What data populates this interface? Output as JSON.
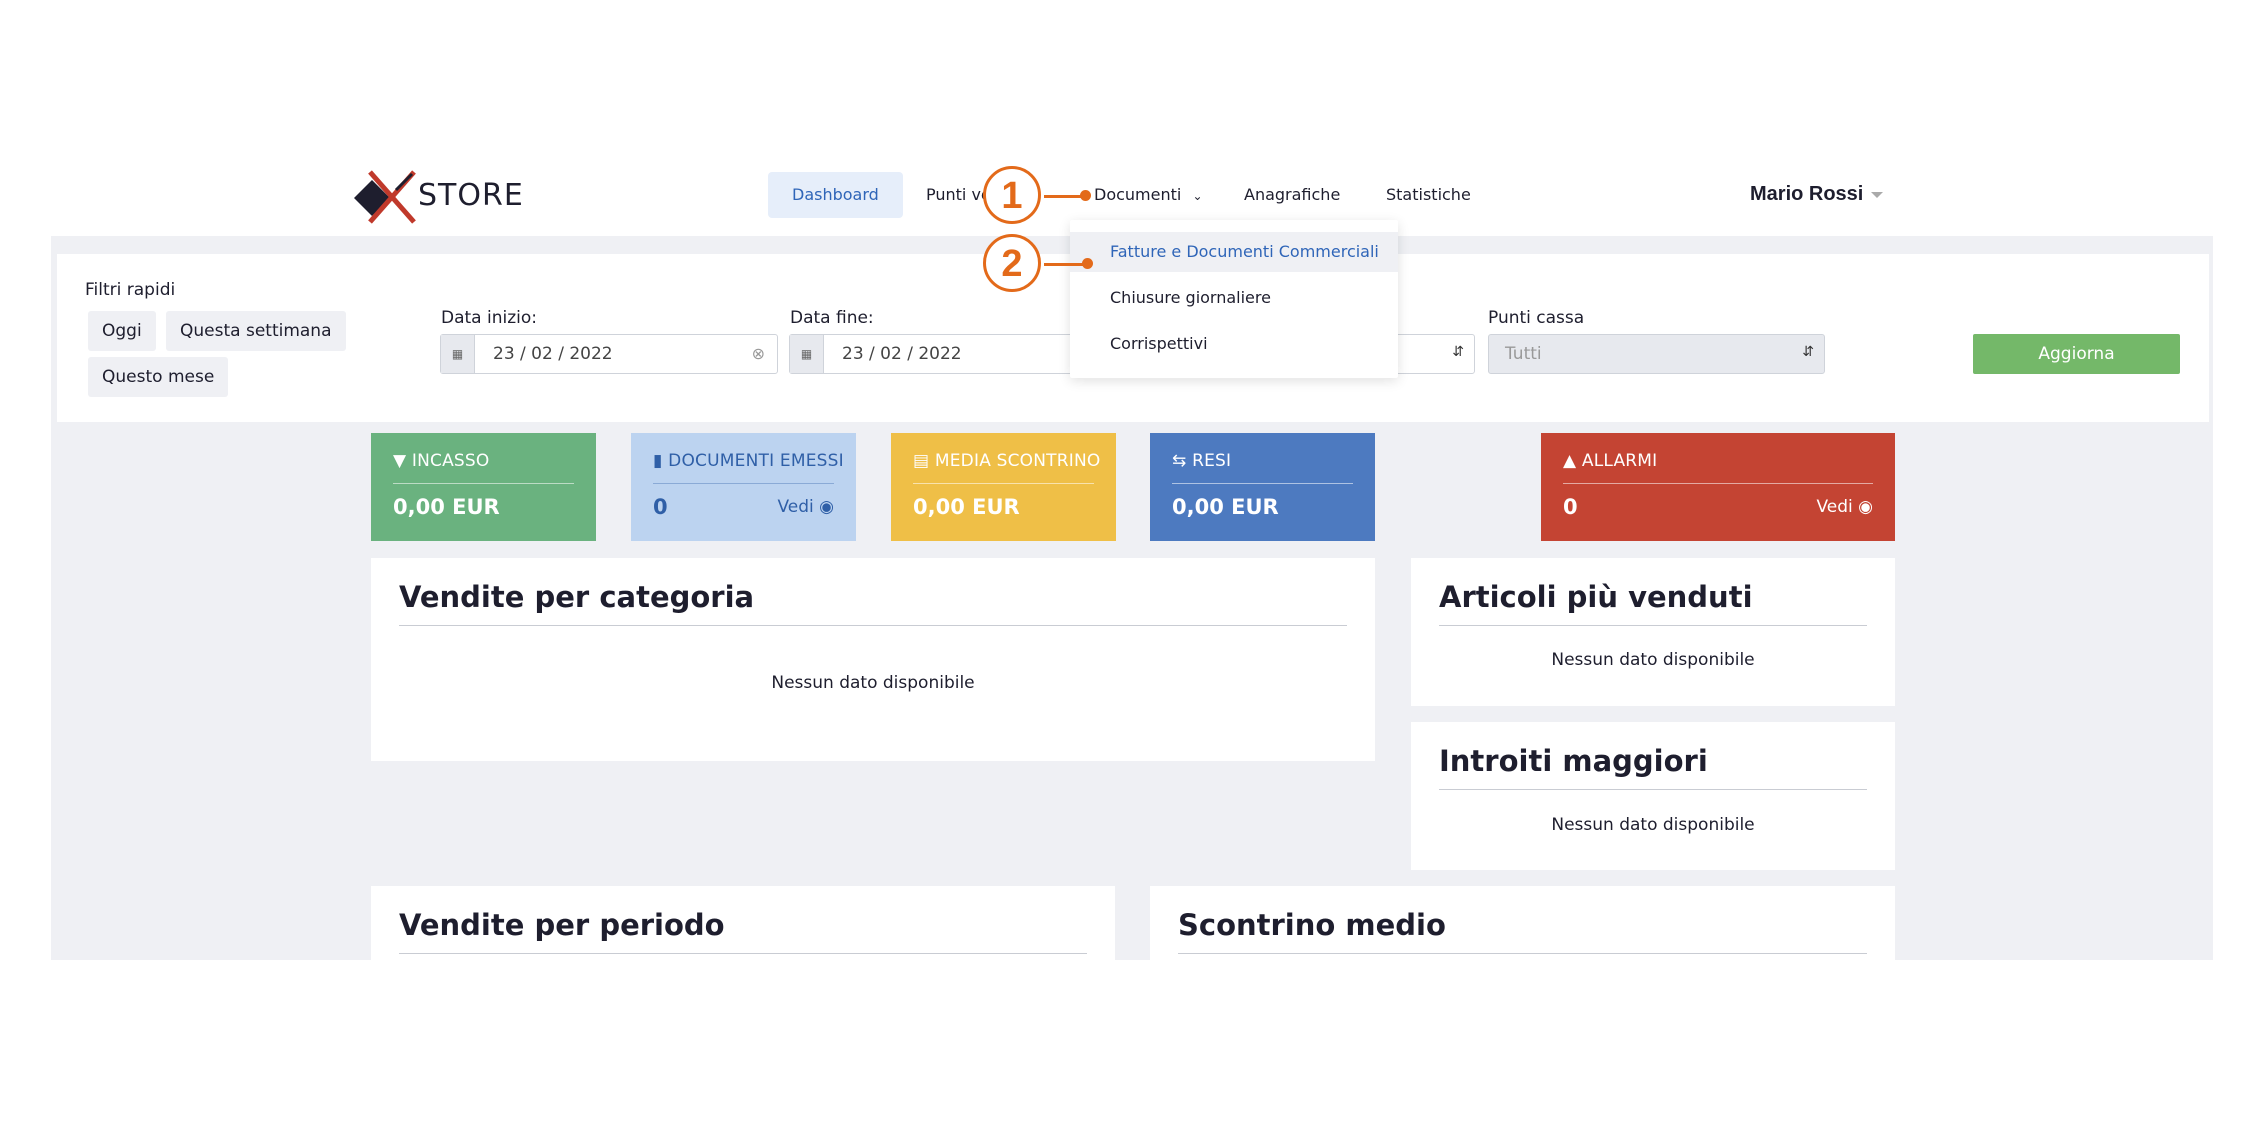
{
  "header": {
    "logo_text": "STORE",
    "nav": [
      "Dashboard",
      "Punti ve",
      "Documenti",
      "Anagrafiche",
      "Statistiche"
    ],
    "user": "Mario Rossi"
  },
  "filters": {
    "quick_label": "Filtri rapidi",
    "quick": [
      "Oggi",
      "Questa settimana",
      "Questo mese"
    ],
    "start_label": "Data inizio:",
    "start_value": "23 / 02 / 2022",
    "end_label": "Data fine:",
    "end_value": "23 / 02 / 2022",
    "pos_label": "Punti cassa",
    "pos_value": "Tutti",
    "update_button": "Aggiorna"
  },
  "dropdown": {
    "items": [
      "Fatture e Documenti Commerciali",
      "Chiusure giornaliere",
      "Corrispettivi"
    ]
  },
  "tiles": [
    {
      "title": "INCASSO",
      "value": "0,00 EUR",
      "color": "#6ab27f"
    },
    {
      "title": "DOCUMENTI EMESSI",
      "value": "0",
      "link": "Vedi",
      "color": "#bcd3f0"
    },
    {
      "title": "MEDIA SCONTRINO",
      "value": "0,00 EUR",
      "color": "#efbf47"
    },
    {
      "title": "RESI",
      "value": "0,00 EUR",
      "color": "#4d7ac0"
    },
    {
      "title": "ALLARMI",
      "value": "0",
      "link": "Vedi",
      "color": "#c44433"
    }
  ],
  "cards": {
    "vendite_categoria": {
      "title": "Vendite per categoria",
      "empty": "Nessun dato disponibile"
    },
    "articoli": {
      "title": "Articoli più venduti",
      "empty": "Nessun dato disponibile"
    },
    "introiti": {
      "title": "Introiti maggiori",
      "empty": "Nessun dato disponibile"
    },
    "vendite_periodo": {
      "title": "Vendite per periodo"
    },
    "scontrino_medio": {
      "title": "Scontrino medio"
    }
  },
  "annotations": [
    "1",
    "2"
  ]
}
